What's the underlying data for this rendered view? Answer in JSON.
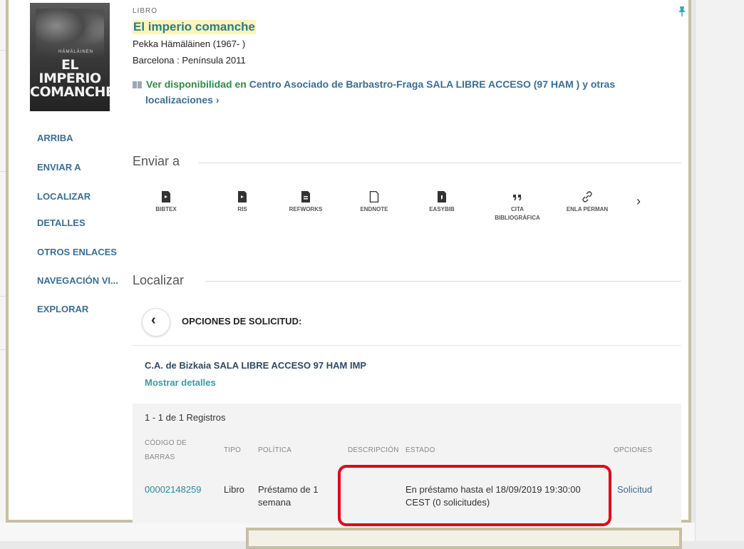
{
  "record": {
    "type": "LIBRO",
    "title": "El imperio comanche",
    "author": "Pekka Hämäläinen (1967- )",
    "publication": "Barcelona : Península 2011",
    "cover_line1": "EL IMPERIO",
    "cover_line2": "COMANCHE",
    "cover_author": "HÄMÄLÄINEN"
  },
  "availability": {
    "prefix": "Ver disponibilidad en",
    "location": "Centro Asociado de Barbastro-Fraga  SALA LIBRE ACCESO (97 HAM ) y otras",
    "more": "localizaciones",
    "more_arrow": "›"
  },
  "side_nav": [
    "ARRIBA",
    "ENVIAR A",
    "LOCALIZAR",
    "DETALLES",
    "OTROS ENLACES",
    "NAVEGACIÓN VI...",
    "EXPLORAR"
  ],
  "send_to": {
    "title": "Enviar a",
    "items": [
      {
        "label": "BIBTEX",
        "icon": "bibtex-icon"
      },
      {
        "label": "RIS",
        "icon": "ris-icon"
      },
      {
        "label": "REFWORKS",
        "icon": "refworks-icon"
      },
      {
        "label": "ENDNOTE",
        "icon": "endnote-icon"
      },
      {
        "label": "EASYBIB",
        "icon": "easybib-icon"
      },
      {
        "label": "CITA BIBLIOGRÁFICA",
        "icon": "quote-icon"
      },
      {
        "label": "ENLA PERMAN",
        "icon": "link-icon"
      }
    ],
    "next": "›"
  },
  "locate": {
    "title": "Localizar",
    "back": "‹",
    "options_title": "OPCIONES DE SOLICITUD:",
    "location_name": "C.A. de Bizkaia  SALA LIBRE ACCESO  97 HAM IMP",
    "show_details": "Mostrar detalles",
    "records_count": "1 - 1 de 1 Registros",
    "columns": {
      "barcode": "CÓDIGO DE BARRAS",
      "type": "TIPO",
      "policy": "POLÍTICA",
      "description": "DESCRIPCIÓN",
      "status": "ESTADO",
      "options": "OPCIONES"
    },
    "row": {
      "barcode": "00002148259",
      "type": "Libro",
      "policy": "Préstamo de 1 semana",
      "description": "",
      "status": "En préstamo hasta el 18/09/2019 19:30:00 CEST (0 solicitudes)",
      "option": "Solicitud"
    }
  },
  "colors": {
    "link": "#3a6e93",
    "title": "#2a7c8c",
    "green": "#2f8b45",
    "frame": "#c6bfa4",
    "highlight": "#e2001a"
  }
}
